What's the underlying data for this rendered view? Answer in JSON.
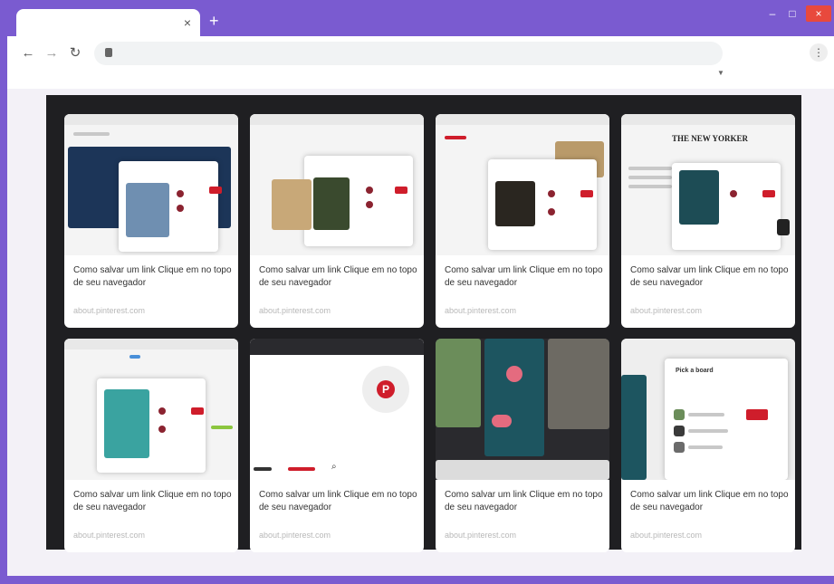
{
  "browser": {
    "tab_close": "×",
    "new_tab": "+",
    "controls": {
      "minimize": "–",
      "maximize": "□",
      "close": "×"
    },
    "menu": "⋮"
  },
  "cards": [
    {
      "title": "Como salvar um link Clique em no topo de seu navegador",
      "source": "about.pinterest.com"
    },
    {
      "title": "Como salvar um link Clique em no topo de seu navegador",
      "source": "about.pinterest.com"
    },
    {
      "title": "Como salvar um link Clique em no topo de seu navegador",
      "source": "about.pinterest.com"
    },
    {
      "title": "Como salvar um link Clique em no topo de seu navegador",
      "source": "about.pinterest.com"
    },
    {
      "title": "Como salvar um link Clique em no topo de seu navegador",
      "source": "about.pinterest.com"
    },
    {
      "title": "Como salvar um link Clique em no topo de seu navegador",
      "source": "about.pinterest.com"
    },
    {
      "title": "Como salvar um link Clique em no topo de seu navegador",
      "source": "about.pinterest.com"
    },
    {
      "title": "Como salvar um link Clique em no topo de seu navegador",
      "source": "about.pinterest.com"
    }
  ],
  "thumbs": {
    "nyer_masthead": "THE NEW YORKER",
    "pin_letter": "P",
    "pick_board": "Pick a board"
  },
  "colors": {
    "accent": "#7a5bd0",
    "pinterest_red": "#cf1d2b",
    "stage": "#1f1f22"
  }
}
